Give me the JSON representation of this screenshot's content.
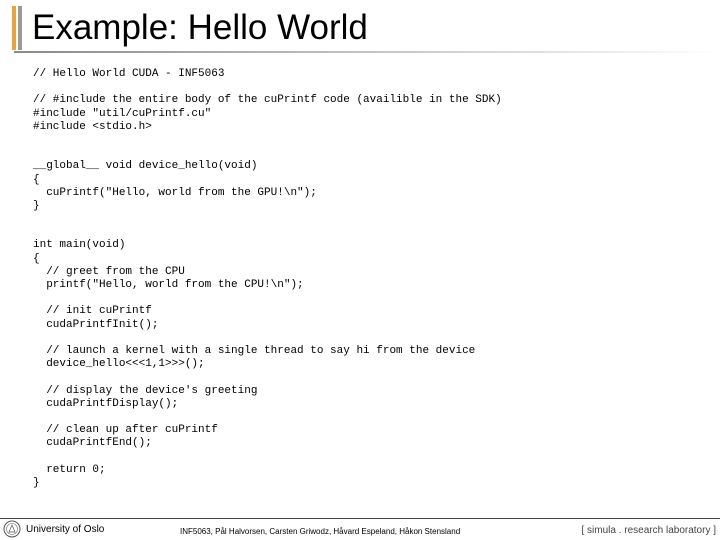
{
  "slide": {
    "title": "Example: Hello World"
  },
  "code_lines": [
    "// Hello World CUDA - INF5063",
    "",
    "// #include the entire body of the cuPrintf code (availible in the SDK)",
    "#include \"util/cuPrintf.cu\"",
    "#include <stdio.h>",
    "",
    "",
    "__global__ void device_hello(void)",
    "{",
    "  cuPrintf(\"Hello, world from the GPU!\\n\");",
    "}",
    "",
    "",
    "int main(void)",
    "{",
    "  // greet from the CPU",
    "  printf(\"Hello, world from the CPU!\\n\");",
    "",
    "  // init cuPrintf",
    "  cudaPrintfInit();",
    "",
    "  // launch a kernel with a single thread to say hi from the device",
    "  device_hello<<<1,1>>>();",
    "",
    "  // display the device's greeting",
    "  cudaPrintfDisplay();",
    "",
    "  // clean up after cuPrintf",
    "  cudaPrintfEnd();",
    "",
    "  return 0;",
    "}"
  ],
  "footer": {
    "institution": "University of Oslo",
    "authors": "INF5063, Pål Halvorsen, Carsten Griwodz, Håvard Espeland, Håkon Stensland",
    "lab": "[ simula . research laboratory ]"
  }
}
